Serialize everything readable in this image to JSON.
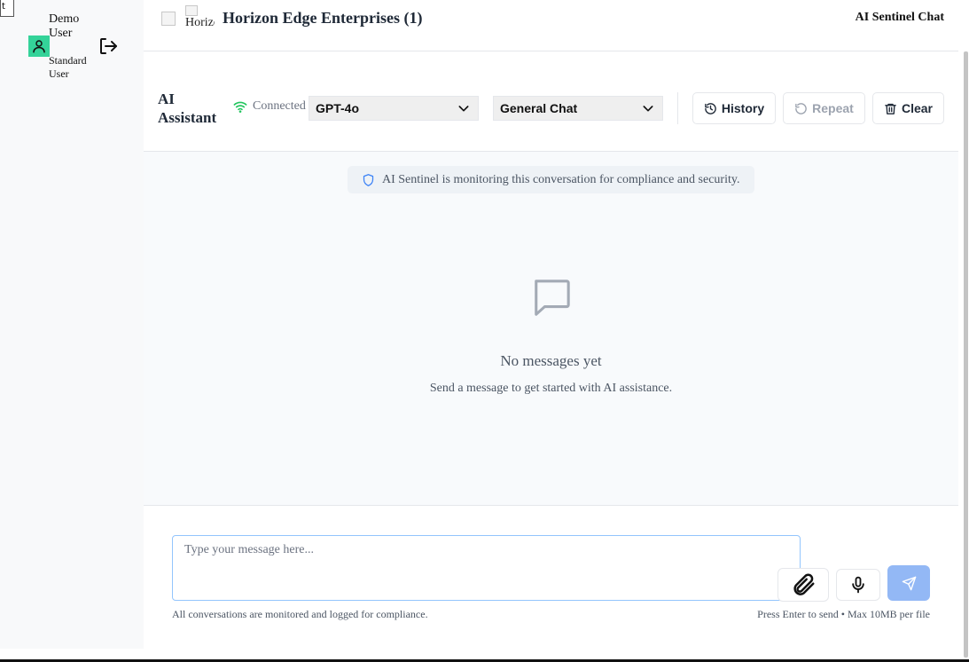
{
  "sidebar": {
    "corner_button_label": "t",
    "user_name": "Demo User",
    "user_role": "Standard User",
    "avatar_icon": "user-icon",
    "logout_icon": "logout-icon",
    "avatar_color": "#34d399"
  },
  "header": {
    "logo_alt": "Horizon",
    "org_title": "Horizon Edge Enterprises (1)",
    "app_title": "AI Sentinel Chat"
  },
  "toolbar": {
    "assistant_title": "AI Assistant",
    "status_text": "Connected",
    "status_color": "#22c55e",
    "model_selected": "GPT-4o",
    "mode_selected": "General Chat",
    "history_label": "History",
    "repeat_label": "Repeat",
    "clear_label": "Clear"
  },
  "chat": {
    "notice": "AI Sentinel is monitoring this conversation for compliance and security.",
    "empty_title": "No messages yet",
    "empty_subtitle": "Send a message to get started with AI assistance."
  },
  "composer": {
    "placeholder": "Type your message here...",
    "value": "",
    "footnote_left": "All conversations are monitored and logged for compliance.",
    "footnote_right": "Press Enter to send • Max 10MB per file",
    "send_color": "#93b8f5"
  }
}
